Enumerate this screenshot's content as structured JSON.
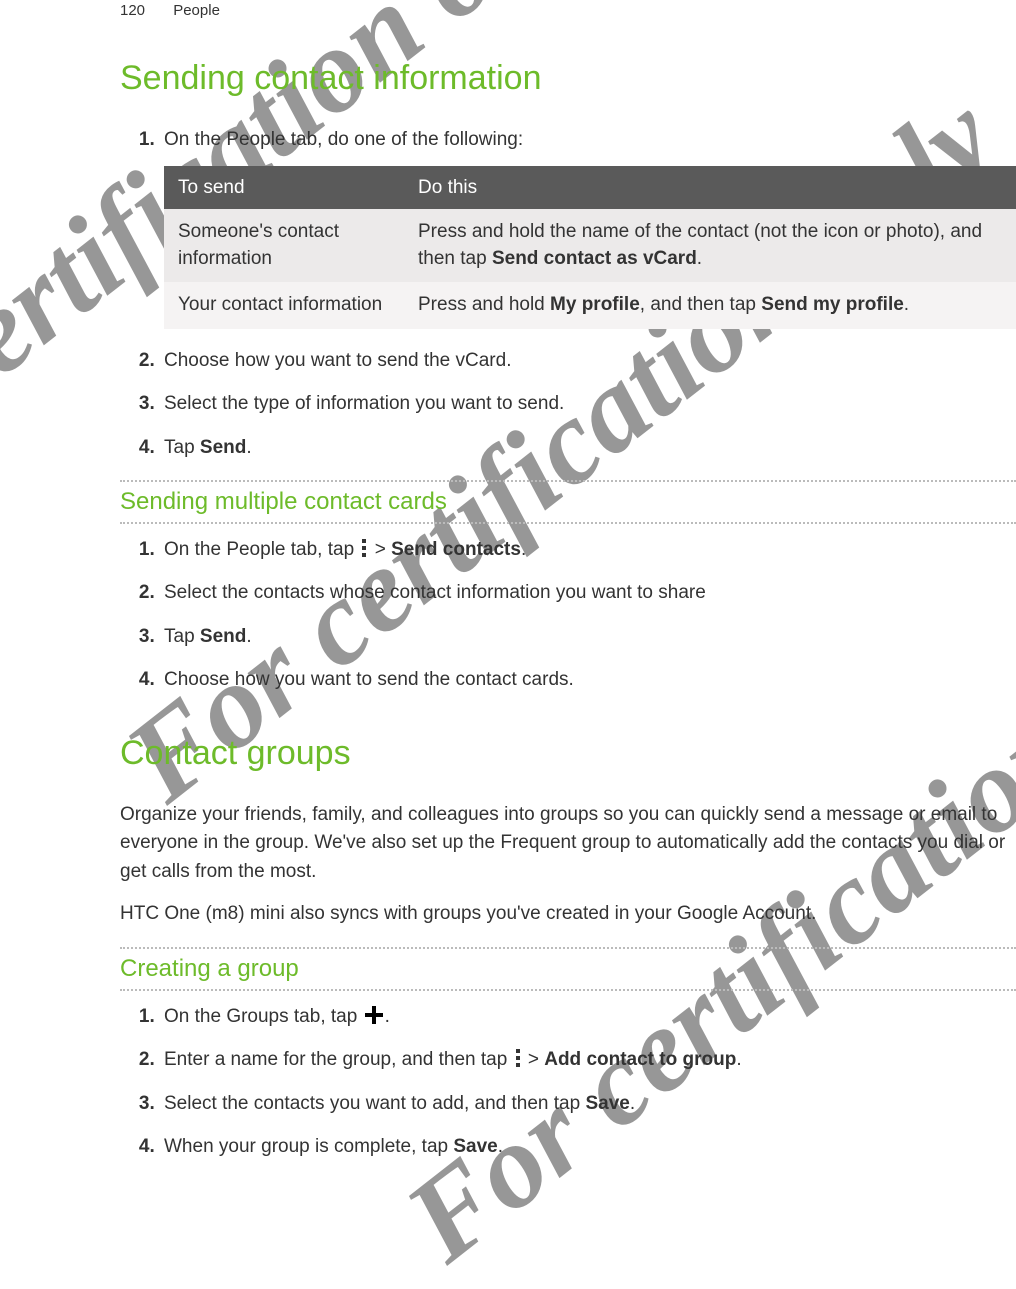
{
  "header": {
    "page_number": "120",
    "section": "People"
  },
  "watermark_text": "For certification only",
  "sections": {
    "s1": {
      "title": "Sending contact information",
      "step1": "On the People tab, do one of the following:",
      "table": {
        "h1": "To send",
        "h2": "Do this",
        "r0c0": "Someone's contact information",
        "r0c1a": "Press and hold the name of the contact (not the icon or photo), and then tap ",
        "r0c1b": "Send contact as vCard",
        "r0c1c": ".",
        "r1c0": "Your contact information",
        "r1c1a": "Press and hold ",
        "r1c1b": "My profile",
        "r1c1c": ", and then tap ",
        "r1c1d": "Send my profile",
        "r1c1e": "."
      },
      "step2": "Choose how you want to send the vCard.",
      "step3": "Select the type of information you want to send.",
      "step4a": "Tap ",
      "step4b": "Send",
      "step4c": "."
    },
    "s2": {
      "title": "Sending multiple contact cards",
      "step1a": "On the People tab, tap ",
      "step1b": " > ",
      "step1c": "Send contacts",
      "step1d": ".",
      "step2": "Select the contacts whose contact information you want to share",
      "step3a": "Tap ",
      "step3b": "Send",
      "step3c": ".",
      "step4": "Choose how you want to send the contact cards."
    },
    "s3": {
      "title": "Contact groups",
      "p1": "Organize your friends, family, and colleagues into groups so you can quickly send a message or email to everyone in the group. We've also set up the Frequent group to automatically add the contacts you dial or get calls from the most.",
      "p2": "HTC One (m8) mini also syncs with groups you've created in your Google Account."
    },
    "s4": {
      "title": "Creating a group",
      "step1a": "On the Groups tab, tap ",
      "step1b": ".",
      "step2a": "Enter a name for the group, and then tap ",
      "step2b": " > ",
      "step2c": "Add contact to group",
      "step2d": ".",
      "step3a": "Select the contacts you want to add, and then tap ",
      "step3b": "Save",
      "step3c": ".",
      "step4a": "When your group is complete, tap ",
      "step4b": "Save",
      "step4c": "."
    }
  }
}
